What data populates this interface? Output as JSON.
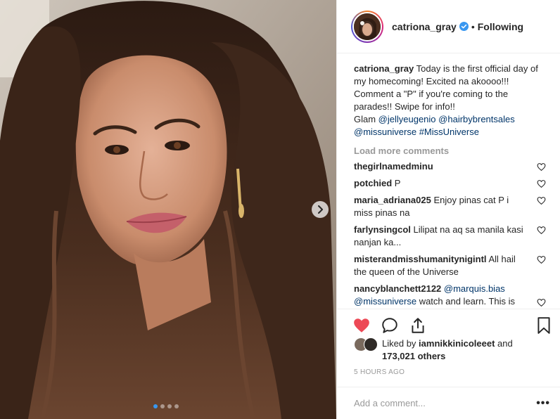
{
  "post": {
    "username": "catriona_gray",
    "follow_status": "Following",
    "bullet": "•",
    "caption": {
      "text_1": "Today is the first official day of my homecoming! Excited na akoooo!!! ",
      "emoji_1": "",
      "text_2": " Comment a \"",
      "emoji_2": "P",
      "text_3": "\" if you're coming to the parades!! Swipe for info!! ",
      "sparkles": "",
      "glam_label": "Glam ",
      "mention_1": "@jellyeugenio",
      "mention_2": "@hairbybrentsales",
      "mention_3": "@missuniverse",
      "hashtag": "#MissUniverse"
    },
    "load_more": "Load more comments",
    "comments": [
      {
        "user": "thegirlnamedminu",
        "text": " "
      },
      {
        "user": "potchied",
        "text": "P"
      },
      {
        "user": "maria_adriana025",
        "text": "Enjoy pinas cat P i miss pinas na "
      },
      {
        "user": "farlynsingcol",
        "text": "Lilipat na aq sa manila kasi nanjan ka... "
      },
      {
        "user": "misterandmisshumanitynigintl",
        "text": "All hail the queen of the Universe"
      },
      {
        "user": "nancyblanchett2122",
        "mention_1": "@marquis.bias",
        "mention_2": "@missuniverse",
        "text": "watch and learn. This is"
      }
    ],
    "likes": {
      "prefix": "Liked by ",
      "user": "iamnikkinicoleeet",
      "and": " and ",
      "count": "173,021 others"
    },
    "time": "5 HOURS AGO",
    "add_comment_placeholder": "Add a comment...",
    "more_options": "•••",
    "slides": {
      "total": 4,
      "active": 1
    }
  },
  "colors": {
    "heart_liked": "#ed4956",
    "link": "#003569",
    "verified": "#3897f0",
    "muted": "#999999"
  },
  "icons": [
    "verified-badge-icon",
    "chevron-right-icon",
    "heart-icon",
    "comment-icon",
    "share-icon",
    "bookmark-icon"
  ]
}
